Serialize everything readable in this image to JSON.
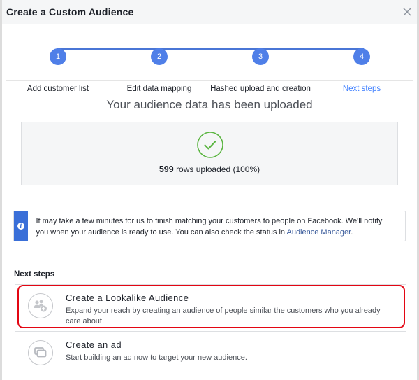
{
  "dialog": {
    "title": "Create a Custom Audience",
    "close_icon": "close-icon"
  },
  "stepper": {
    "steps": [
      {
        "number": "1",
        "label": "Add customer list",
        "active": false
      },
      {
        "number": "2",
        "label": "Edit data mapping",
        "active": false
      },
      {
        "number": "3",
        "label": "Hashed upload and creation",
        "active": false
      },
      {
        "number": "4",
        "label": "Next steps",
        "active": true
      }
    ],
    "accent_color": "#4f7fe8"
  },
  "upload": {
    "title": "Your audience data has been uploaded",
    "status_icon": "check-circle-icon",
    "rows_count": "599",
    "rows_text": "rows uploaded (100%)",
    "progress_percent": 100,
    "status_color": "#5ab540"
  },
  "notice": {
    "icon": "info-icon",
    "text": "It may take a few minutes for us to finish matching your customers to people on Facebook. We'll notify you when your audience is ready to use. You can also check the status in ",
    "link_text": "Audience Manager",
    "trailing": "."
  },
  "next_steps": {
    "heading": "Next steps",
    "options": [
      {
        "icon": "add-people-icon",
        "title": "Create a Lookalike Audience",
        "description": "Expand your reach by creating an audience of people similar the customers who you already care about.",
        "highlighted": true
      },
      {
        "icon": "create-ad-icon",
        "title": "Create an ad",
        "description": "Start building an ad now to target your new audience.",
        "highlighted": false
      }
    ],
    "highlight_color": "#e30613"
  }
}
